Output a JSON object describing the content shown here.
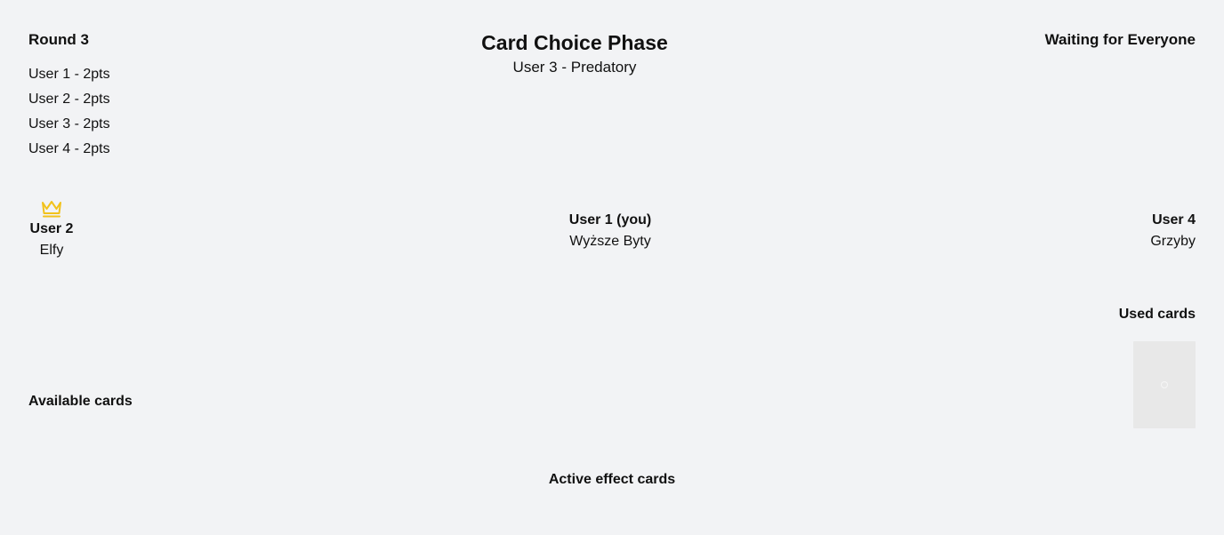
{
  "scoreboard": {
    "round_label": "Round 3",
    "scores": [
      "User 1 - 2pts",
      "User 2 - 2pts",
      "User 3 - 2pts",
      "User 4 - 2pts"
    ]
  },
  "phase": {
    "title": "Card Choice Phase",
    "subtitle": "User 3 - Predatory"
  },
  "status": {
    "text": "Waiting for Everyone"
  },
  "players": {
    "left": {
      "name": "User 2",
      "faction": "Elfy",
      "icon": "crown-icon"
    },
    "center": {
      "name": "User 1 (you)",
      "faction": "Wyższe Byty"
    },
    "right": {
      "name": "User 4",
      "faction": "Grzyby"
    }
  },
  "sections": {
    "used_cards": "Used cards",
    "available_cards": "Available cards",
    "active_effect_cards": "Active effect cards"
  },
  "colors": {
    "background": "#f2f3f5",
    "crown": "#f2c21b",
    "card_back": "#e8e8e8"
  }
}
